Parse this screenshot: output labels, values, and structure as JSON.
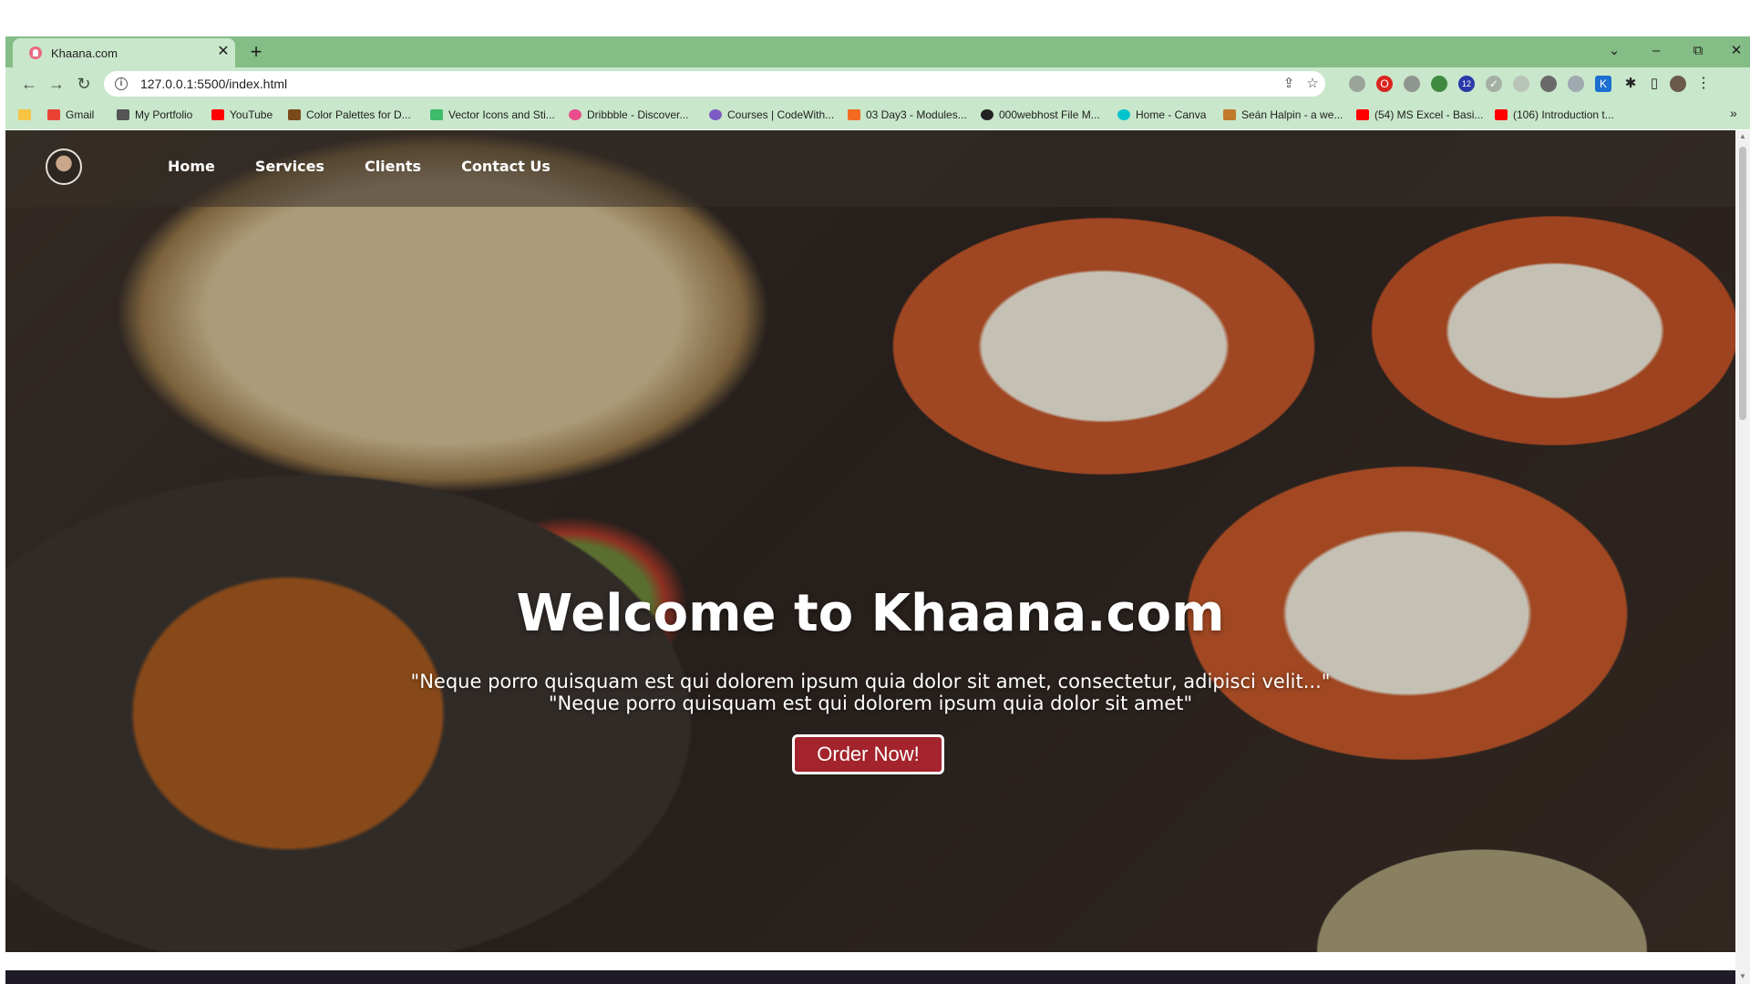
{
  "browser": {
    "tab_title": "Khaana.com",
    "tab_close": "✕",
    "new_tab": "+",
    "url": "127.0.0.1:5500/index.html",
    "controls": {
      "tab_search": "⌄",
      "minimize": "–",
      "restore": "⧉",
      "close": "✕"
    },
    "nav": {
      "back": "←",
      "forward": "→",
      "reload": "↻"
    },
    "bookmarks": [
      {
        "label": "",
        "icon": "folder-icon",
        "color": "#f6c343"
      },
      {
        "label": "Gmail",
        "icon": "gmail-icon",
        "color": "#ea4335"
      },
      {
        "label": "My Portfolio",
        "icon": "document-icon",
        "color": "#555555"
      },
      {
        "label": "YouTube",
        "icon": "youtube-icon",
        "color": "#ff0000"
      },
      {
        "label": "Color Palettes for D...",
        "icon": "palette-icon",
        "color": "#7a4a1a"
      },
      {
        "label": "Vector Icons and Sti...",
        "icon": "vector-icon",
        "color": "#3dbb6b"
      },
      {
        "label": "Dribbble - Discover...",
        "icon": "dribbble-icon",
        "color": "#ea4c89"
      },
      {
        "label": "Courses | CodeWith...",
        "icon": "course-icon",
        "color": "#7c5cc4"
      },
      {
        "label": "03 Day3 - Modules...",
        "icon": "modules-icon",
        "color": "#f26b21"
      },
      {
        "label": "000webhost File M...",
        "icon": "webhost-icon",
        "color": "#222222"
      },
      {
        "label": "Home - Canva",
        "icon": "canva-icon",
        "color": "#00c4cc"
      },
      {
        "label": "Seán Halpin - a we...",
        "icon": "person-icon",
        "color": "#c07a2a"
      },
      {
        "label": "(54) MS Excel - Basi...",
        "icon": "youtube-icon",
        "color": "#ff0000"
      },
      {
        "label": "(106) Introduction t...",
        "icon": "youtube-icon",
        "color": "#ff0000"
      }
    ],
    "bookmarks_more": "»",
    "extension_badge": "12"
  },
  "site": {
    "nav": {
      "home": "Home",
      "services": "Services",
      "clients": "Clients",
      "contact": "Contact Us"
    },
    "hero": {
      "title": "Welcome to Khaana.com",
      "line1": "\"Neque porro quisquam est qui dolorem ipsum quia dolor sit amet, consectetur, adipisci velit...\"",
      "line2": "\"Neque porro quisquam est qui dolorem ipsum quia dolor sit amet\"",
      "button": "Order Now!"
    },
    "colors": {
      "accent": "#a3242c",
      "chrome": "#84bd85",
      "toolbar": "#c9e7cb"
    }
  }
}
